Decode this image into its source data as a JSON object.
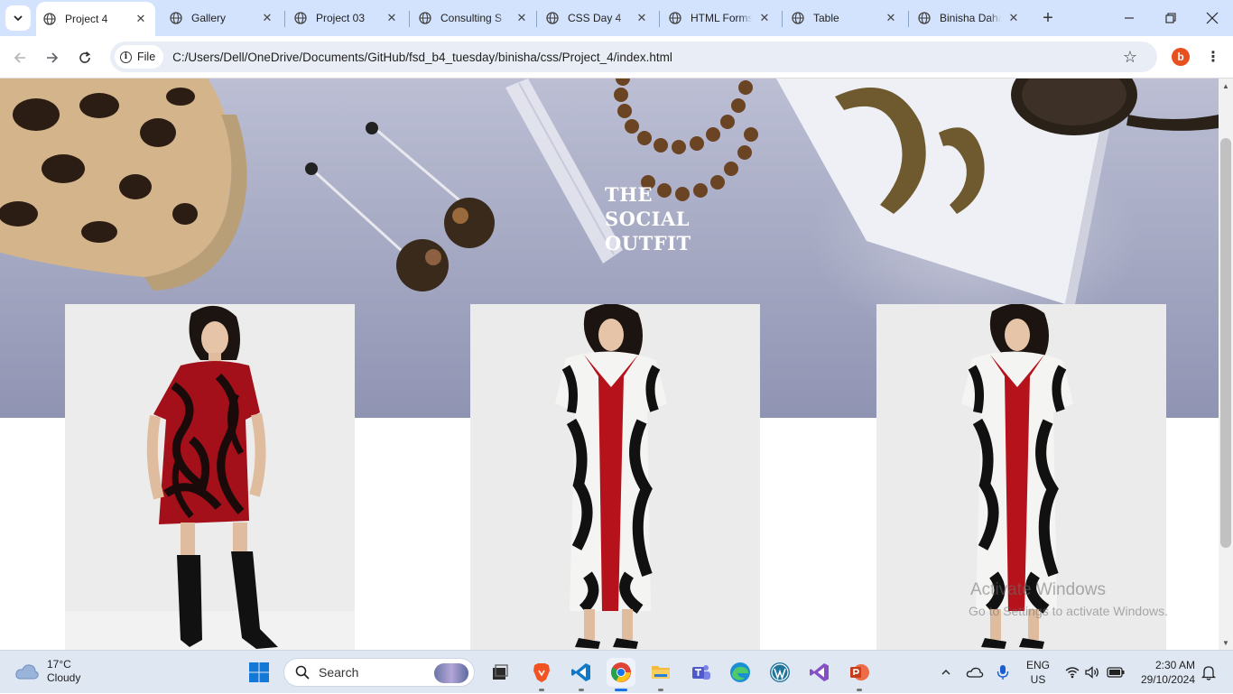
{
  "browser": {
    "tabs": [
      {
        "label": "Project 4",
        "active": true
      },
      {
        "label": "Gallery"
      },
      {
        "label": "Project 03"
      },
      {
        "label": "Consulting S"
      },
      {
        "label": "CSS Day 4"
      },
      {
        "label": "HTML Forms"
      },
      {
        "label": "Table"
      },
      {
        "label": "Binisha Daha"
      }
    ],
    "new_tab_glyph": "+",
    "chip_label": "File",
    "url": "C:/Users/Dell/OneDrive/Documents/GitHub/fsd_b4_tuesday/binisha/css/Project_4/index.html",
    "profile_initial": "b"
  },
  "page": {
    "brand_name": "THE\nSOCIAL\nOUTFIT",
    "products": [
      {
        "image": "woman in red and black patterned mini dress with black knee-high boots"
      },
      {
        "image": "woman in black and white printed maxi dress with red front panel"
      },
      {
        "image": "woman in black and white printed maxi dress with red front panel"
      }
    ]
  },
  "watermark": {
    "line1": "Activate Windows",
    "line2": "Go to Settings to activate Windows."
  },
  "taskbar": {
    "weather_temp": "17°C",
    "weather_desc": "Cloudy",
    "search_placeholder": "Search",
    "apps": [
      "task-view",
      "brave",
      "vscode",
      "chrome",
      "file-explorer",
      "teams",
      "edge",
      "wordpress",
      "visual-studio",
      "powerpoint"
    ],
    "lang_line1": "ENG",
    "lang_line2": "US",
    "time": "2:30 AM",
    "date": "29/10/2024"
  },
  "colors": {
    "tab_strip": "#d3e3fd",
    "accent_red": "#b5121b",
    "taskbar": "#dfe7f3"
  }
}
